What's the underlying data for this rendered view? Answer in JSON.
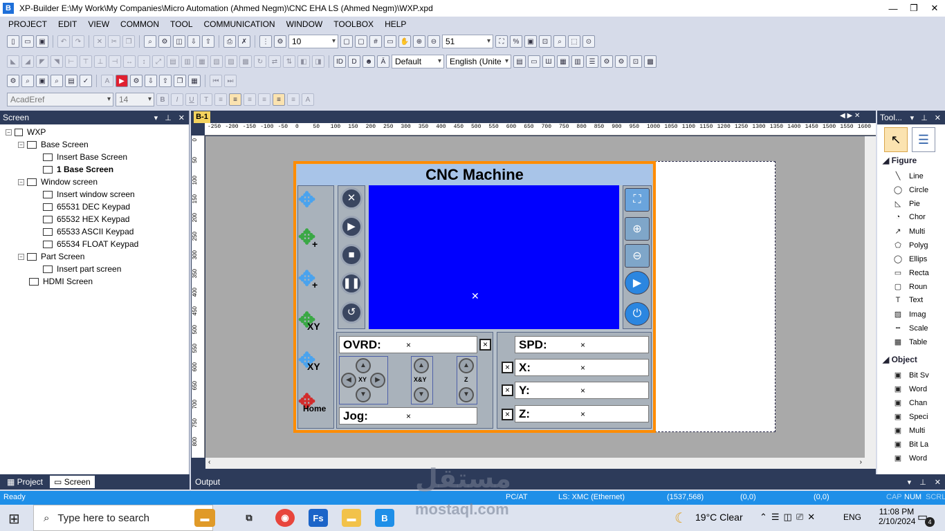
{
  "window": {
    "title": "XP-Builder E:\\My Work\\My Companies\\Micro Automation (Ahmed Negm)\\CNC EHA LS (Ahmed Negm)\\WXP.xpd",
    "app_icon": "B"
  },
  "menu": [
    "PROJECT",
    "EDIT",
    "VIEW",
    "COMMON",
    "TOOL",
    "COMMUNICATION",
    "WINDOW",
    "TOOLBOX",
    "HELP"
  ],
  "toolbar": {
    "grid_size": "10",
    "zoom": "51",
    "style": "Default",
    "language": "English (Unite",
    "font": "AcadEref",
    "font_size": "14"
  },
  "screen_panel": {
    "title": "Screen",
    "root": "WXP",
    "base_screen": "Base Screen",
    "insert_base_screen": "Insert Base Screen",
    "base_screen_1": "1 Base Screen",
    "window_screen": "Window screen",
    "insert_window_screen": "Insert window screen",
    "keypad_dec": "65531 DEC Keypad",
    "keypad_hex": "65532 HEX Keypad",
    "keypad_ascii": "65533 ASCII Keypad",
    "keypad_float": "65534 FLOAT Keypad",
    "part_screen": "Part Screen",
    "insert_part_screen": "Insert part screen",
    "hdmi_screen": "HDMI Screen"
  },
  "bottom_tabs": {
    "project": "Project",
    "screen": "Screen"
  },
  "doc_tab": "B-1",
  "ruler_labels": [
    "-250",
    "-200",
    "-150",
    "-100",
    "-50",
    "0",
    "50",
    "100",
    "150",
    "200",
    "250",
    "300",
    "350",
    "400",
    "450",
    "500",
    "550",
    "600",
    "650",
    "700",
    "750",
    "800",
    "850",
    "900",
    "950",
    "1000",
    "1050",
    "1100",
    "1150",
    "1200",
    "1250",
    "1300",
    "1350",
    "1400",
    "1450",
    "1500",
    "1550",
    "1600"
  ],
  "ruler_left_labels": [
    "0",
    "50",
    "100",
    "150",
    "200",
    "250",
    "300",
    "350",
    "400",
    "450",
    "500",
    "550",
    "600",
    "650",
    "700",
    "750",
    "800"
  ],
  "hmi": {
    "title": "CNC Machine",
    "left_labels": {
      "plus1": "+",
      "plus2": "+",
      "xy1": "XY",
      "xy2": "XY",
      "home": "Home"
    },
    "ovrd": "OVRD:",
    "jog": "Jog:",
    "spd": "SPD:",
    "x": "X:",
    "y": "Y:",
    "z": "Z:",
    "jog_labels": {
      "xy": "XY",
      "xxy": "X&Y",
      "z": "Z"
    },
    "mark": "×"
  },
  "toolbox": {
    "title": "Tool...",
    "figure_section": "Figure",
    "figure_items": [
      "Line",
      "Circle",
      "Pie",
      "Chor",
      "Multi",
      "Polyg",
      "Ellips",
      "Recta",
      "Roun",
      "Text",
      "Imag",
      "Scale",
      "Table"
    ],
    "object_section": "Object",
    "object_items": [
      "Bit Sv",
      "Word",
      "Chan",
      "Speci",
      "Multi",
      "Bit La",
      "Word"
    ]
  },
  "output_title": "Output",
  "status": {
    "left": "Ready",
    "mode": "PC/AT",
    "ls": "LS: XMC (Ethernet)",
    "coords": "(1537,568)",
    "c1": "(0,0)",
    "c2": "(0,0)",
    "cap": "CAP",
    "num": "NUM",
    "scrl": "SCRL"
  },
  "taskbar": {
    "search": "Type here to search",
    "weather": "19°C  Clear",
    "lang": "ENG",
    "time": "11:08 PM",
    "date": "2/10/2024",
    "notif": "4"
  },
  "watermark": {
    "line1": "مستقل",
    "line2": "mostaql.com"
  }
}
